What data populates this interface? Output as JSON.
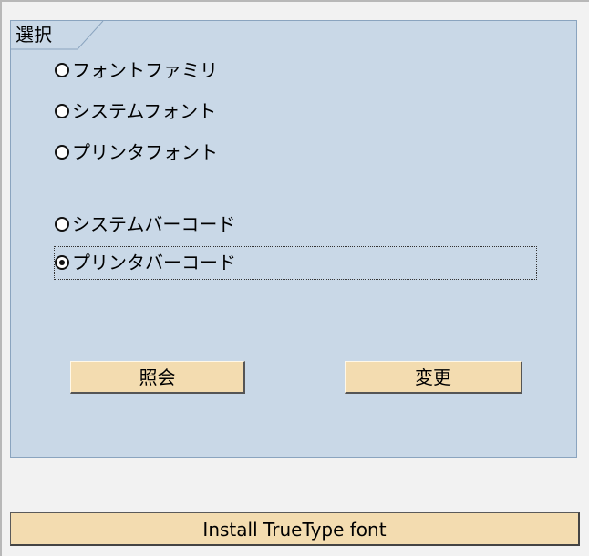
{
  "group": {
    "title": "選択",
    "options": [
      {
        "label": "フォントファミリ",
        "selected": false
      },
      {
        "label": "システムフォント",
        "selected": false
      },
      {
        "label": "プリンタフォント",
        "selected": false
      },
      {
        "label": "システムバーコード",
        "selected": false
      },
      {
        "label": "プリンタバーコード",
        "selected": true
      }
    ]
  },
  "buttons": {
    "inquiry_label": "照会",
    "change_label": "変更",
    "install_label": "Install TrueType font"
  },
  "colors": {
    "group_background": "#c9d8e7",
    "button_background": "#f3dcb0",
    "page_background": "#f2f2f2"
  }
}
